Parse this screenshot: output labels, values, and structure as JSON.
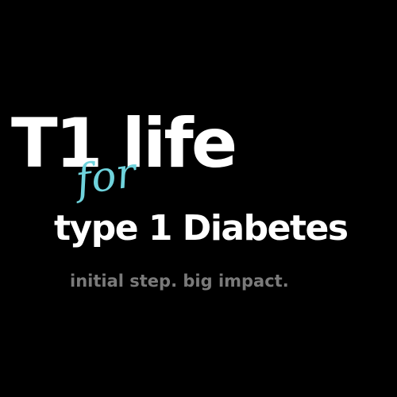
{
  "logo": {
    "title": "T1 life",
    "script_word": "for",
    "subtitle": "type 1 Diabetes",
    "tagline": "initial step. big impact."
  },
  "colors": {
    "background": "#000000",
    "primary_text": "#ffffff",
    "accent": "#6fd3dc",
    "tagline": "#7a7a7a"
  }
}
